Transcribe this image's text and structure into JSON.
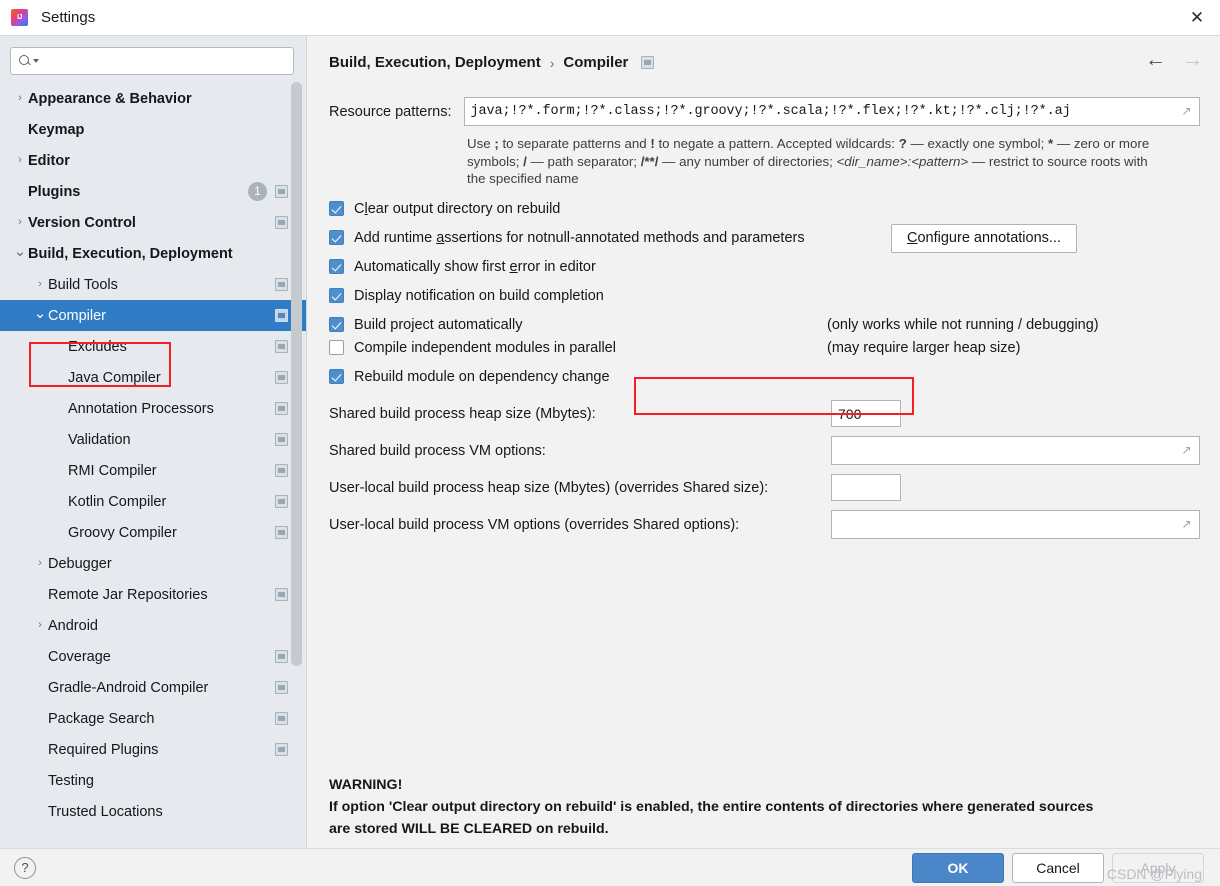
{
  "window": {
    "title": "Settings",
    "app_icon": "intellij-idea-icon",
    "close_icon": "close-icon"
  },
  "sidebar": {
    "search": {
      "placeholder": "",
      "value": "",
      "icon": "search-icon",
      "caret_icon": "chevron-down-icon"
    },
    "items": [
      {
        "label": "Appearance & Behavior",
        "arrow": "collapsed",
        "bold": true,
        "indent": 0,
        "marker": false,
        "badge": null,
        "selected": false
      },
      {
        "label": "Keymap",
        "arrow": "none",
        "bold": true,
        "indent": 0,
        "marker": false,
        "badge": null,
        "selected": false
      },
      {
        "label": "Editor",
        "arrow": "collapsed",
        "bold": true,
        "indent": 0,
        "marker": false,
        "badge": null,
        "selected": false
      },
      {
        "label": "Plugins",
        "arrow": "none",
        "bold": true,
        "indent": 0,
        "marker": true,
        "badge": "1",
        "selected": false
      },
      {
        "label": "Version Control",
        "arrow": "collapsed",
        "bold": true,
        "indent": 0,
        "marker": true,
        "badge": null,
        "selected": false
      },
      {
        "label": "Build, Execution, Deployment",
        "arrow": "expanded",
        "bold": true,
        "indent": 0,
        "marker": false,
        "badge": null,
        "selected": false
      },
      {
        "label": "Build Tools",
        "arrow": "collapsed",
        "bold": false,
        "indent": 1,
        "marker": true,
        "badge": null,
        "selected": false
      },
      {
        "label": "Compiler",
        "arrow": "expanded",
        "bold": false,
        "indent": 1,
        "marker": true,
        "badge": null,
        "selected": true
      },
      {
        "label": "Excludes",
        "arrow": "none",
        "bold": false,
        "indent": 2,
        "marker": true,
        "badge": null,
        "selected": false
      },
      {
        "label": "Java Compiler",
        "arrow": "none",
        "bold": false,
        "indent": 2,
        "marker": true,
        "badge": null,
        "selected": false
      },
      {
        "label": "Annotation Processors",
        "arrow": "none",
        "bold": false,
        "indent": 2,
        "marker": true,
        "badge": null,
        "selected": false
      },
      {
        "label": "Validation",
        "arrow": "none",
        "bold": false,
        "indent": 2,
        "marker": true,
        "badge": null,
        "selected": false
      },
      {
        "label": "RMI Compiler",
        "arrow": "none",
        "bold": false,
        "indent": 2,
        "marker": true,
        "badge": null,
        "selected": false
      },
      {
        "label": "Kotlin Compiler",
        "arrow": "none",
        "bold": false,
        "indent": 2,
        "marker": true,
        "badge": null,
        "selected": false
      },
      {
        "label": "Groovy Compiler",
        "arrow": "none",
        "bold": false,
        "indent": 2,
        "marker": true,
        "badge": null,
        "selected": false
      },
      {
        "label": "Debugger",
        "arrow": "collapsed",
        "bold": false,
        "indent": 1,
        "marker": false,
        "badge": null,
        "selected": false
      },
      {
        "label": "Remote Jar Repositories",
        "arrow": "none",
        "bold": false,
        "indent": 1,
        "marker": true,
        "badge": null,
        "selected": false
      },
      {
        "label": "Android",
        "arrow": "collapsed",
        "bold": false,
        "indent": 1,
        "marker": false,
        "badge": null,
        "selected": false
      },
      {
        "label": "Coverage",
        "arrow": "none",
        "bold": false,
        "indent": 1,
        "marker": true,
        "badge": null,
        "selected": false
      },
      {
        "label": "Gradle-Android Compiler",
        "arrow": "none",
        "bold": false,
        "indent": 1,
        "marker": true,
        "badge": null,
        "selected": false
      },
      {
        "label": "Package Search",
        "arrow": "none",
        "bold": false,
        "indent": 1,
        "marker": true,
        "badge": null,
        "selected": false
      },
      {
        "label": "Required Plugins",
        "arrow": "none",
        "bold": false,
        "indent": 1,
        "marker": true,
        "badge": null,
        "selected": false
      },
      {
        "label": "Testing",
        "arrow": "none",
        "bold": false,
        "indent": 1,
        "marker": false,
        "badge": null,
        "selected": false
      },
      {
        "label": "Trusted Locations",
        "arrow": "none",
        "bold": false,
        "indent": 1,
        "marker": false,
        "badge": null,
        "selected": false
      }
    ]
  },
  "breadcrumb": {
    "parent": "Build, Execution, Deployment",
    "separator": "›",
    "current": "Compiler",
    "marker_icon": "project-setting-marker-icon",
    "back_icon": "arrow-left-icon",
    "forward_icon": "arrow-right-icon"
  },
  "resource_patterns": {
    "label": "Resource patterns:",
    "value": "java;!?*.form;!?*.class;!?*.groovy;!?*.scala;!?*.flex;!?*.kt;!?*.clj;!?*.aj",
    "expand_icon": "expand-editor-icon",
    "help_parts": [
      {
        "text": "Use ",
        "style": "normal"
      },
      {
        "text": ";",
        "style": "bold"
      },
      {
        "text": " to separate patterns and ",
        "style": "normal"
      },
      {
        "text": "!",
        "style": "bold"
      },
      {
        "text": " to negate a pattern. Accepted wildcards: ",
        "style": "normal"
      },
      {
        "text": "?",
        "style": "bold"
      },
      {
        "text": " — exactly one symbol; ",
        "style": "normal"
      },
      {
        "text": "*",
        "style": "bold"
      },
      {
        "text": " — zero or more symbols; ",
        "style": "normal"
      },
      {
        "text": "/",
        "style": "bold"
      },
      {
        "text": " — path separator; ",
        "style": "normal"
      },
      {
        "text": "/**/",
        "style": "bold"
      },
      {
        "text": " — any number of directories; ",
        "style": "normal"
      },
      {
        "text": "<dir_name>:<pattern>",
        "style": "italic"
      },
      {
        "text": " — restrict to source roots with the specified name",
        "style": "normal"
      }
    ]
  },
  "checkboxes": [
    {
      "label": "Clear output directory on rebuild",
      "mnemonic": "l",
      "checked": true,
      "hint": null
    },
    {
      "label": "Add runtime assertions for notnull-annotated methods and parameters",
      "mnemonic": "a",
      "checked": true,
      "hint": null
    },
    {
      "label": "Automatically show first error in editor",
      "mnemonic": "e",
      "checked": true,
      "hint": null
    },
    {
      "label": "Display notification on build completion",
      "mnemonic": null,
      "checked": true,
      "hint": null
    },
    {
      "label": "Build project automatically",
      "mnemonic": null,
      "checked": true,
      "hint": "(only works while not running / debugging)"
    },
    {
      "label": "Compile independent modules in parallel",
      "mnemonic": null,
      "checked": false,
      "hint": "(may require larger heap size)"
    },
    {
      "label": "Rebuild module on dependency change",
      "mnemonic": null,
      "checked": true,
      "hint": null
    }
  ],
  "configure_button": {
    "label": "Configure annotations...",
    "mnemonic": "C"
  },
  "fields": [
    {
      "label": "Shared build process heap size (Mbytes):",
      "value": "700",
      "type": "small",
      "expandable": false
    },
    {
      "label": "Shared build process VM options:",
      "value": "",
      "type": "wide",
      "expandable": true
    },
    {
      "label": "User-local build process heap size (Mbytes) (overrides Shared size):",
      "value": "",
      "type": "small",
      "expandable": false
    },
    {
      "label": "User-local build process VM options (overrides Shared options):",
      "value": "",
      "type": "wide",
      "expandable": true
    }
  ],
  "warning": {
    "title": "WARNING!",
    "line1": "If option 'Clear output directory on rebuild' is enabled, the entire contents of directories where generated sources",
    "line2": "are stored WILL BE CLEARED on rebuild."
  },
  "footer": {
    "help_label": "?",
    "ok_label": "OK",
    "cancel_label": "Cancel",
    "apply_label": "Apply",
    "apply_disabled": true
  },
  "watermark": "CSDN @Flying",
  "colors": {
    "accent_blue": "#4a86c8",
    "selection_blue": "#2f7bc4",
    "checkbox_blue": "#4d8ecb",
    "annotation_red": "#f51f23",
    "sidebar_bg": "#e6eaee",
    "main_bg": "#f2f2f2"
  }
}
